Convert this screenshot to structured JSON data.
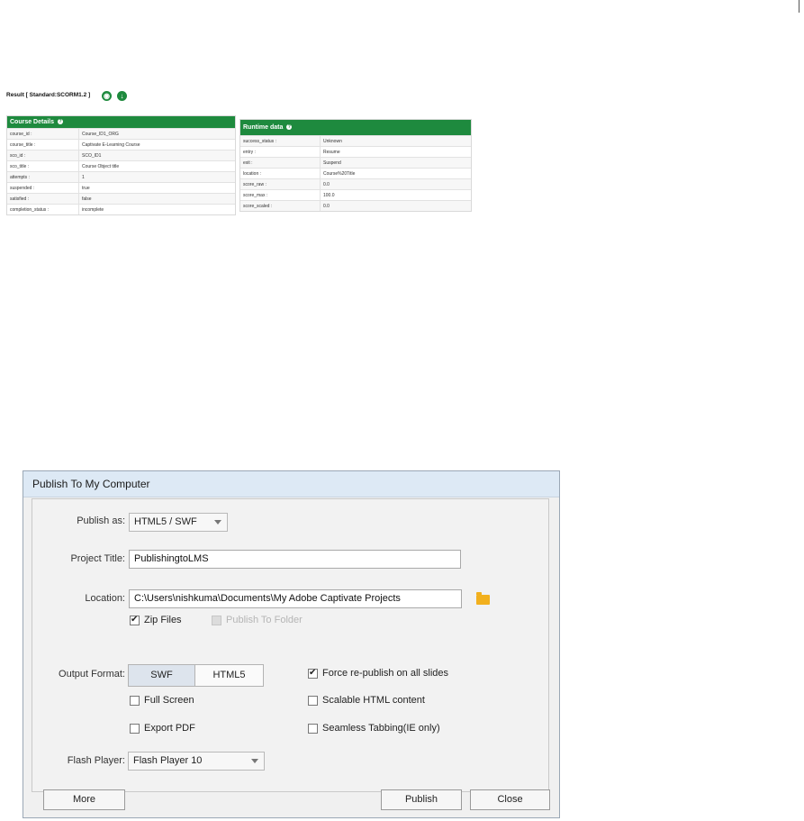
{
  "scorm": {
    "result_title": "Result [ Standard:SCORM1.2 ]",
    "icons": [
      "view-icon",
      "download-icon"
    ],
    "course_details": {
      "title": "Course Details",
      "rows": [
        {
          "key": "course_id :",
          "value": "Course_ID1_ORG"
        },
        {
          "key": "course_title :",
          "value": "Captivate E-Learning Course"
        },
        {
          "key": "sco_id :",
          "value": "SCO_ID1"
        },
        {
          "key": "sco_title :",
          "value": "Course Object title"
        },
        {
          "key": "attempts :",
          "value": "1"
        },
        {
          "key": "suspended :",
          "value": "true"
        },
        {
          "key": "satisfied :",
          "value": "false"
        },
        {
          "key": "completion_status :",
          "value": "incomplete"
        }
      ]
    },
    "runtime_data": {
      "title": "Runtime data",
      "rows": [
        {
          "key": "success_status :",
          "value": "Unknown"
        },
        {
          "key": "entry :",
          "value": "Resume"
        },
        {
          "key": "exit :",
          "value": "Suspend"
        },
        {
          "key": "location :",
          "value": "Course%20Title"
        },
        {
          "key": "score_raw :",
          "value": "0.0"
        },
        {
          "key": "score_max :",
          "value": "100.0"
        },
        {
          "key": "score_scaled :",
          "value": "0.0"
        }
      ]
    },
    "accent_color": "#1e8a3e"
  },
  "dialog": {
    "title": "Publish To My Computer",
    "publish_as": {
      "label": "Publish as:",
      "value": "HTML5 / SWF"
    },
    "project_title": {
      "label": "Project Title:",
      "value": "PublishingtoLMS"
    },
    "location": {
      "label": "Location:",
      "value": "C:\\Users\\nishkuma\\Documents\\My Adobe Captivate Projects"
    },
    "zip_files": {
      "label": "Zip Files",
      "checked": true
    },
    "publish_to_folder": {
      "label": "Publish To Folder",
      "checked": false,
      "enabled": false
    },
    "output_format": {
      "label": "Output Format:",
      "options": [
        "SWF",
        "HTML5"
      ],
      "selected": "SWF"
    },
    "force_republish": {
      "label": "Force re-publish on all slides",
      "checked": true
    },
    "full_screen": {
      "label": "Full Screen",
      "checked": false
    },
    "scalable_html": {
      "label": "Scalable HTML content",
      "checked": false
    },
    "export_pdf": {
      "label": "Export PDF",
      "checked": false
    },
    "seamless_tabbing": {
      "label": "Seamless Tabbing(IE only)",
      "checked": false
    },
    "flash_player": {
      "label": "Flash Player:",
      "value": "Flash Player 10"
    },
    "buttons": {
      "more": "More",
      "publish": "Publish",
      "close": "Close"
    }
  }
}
